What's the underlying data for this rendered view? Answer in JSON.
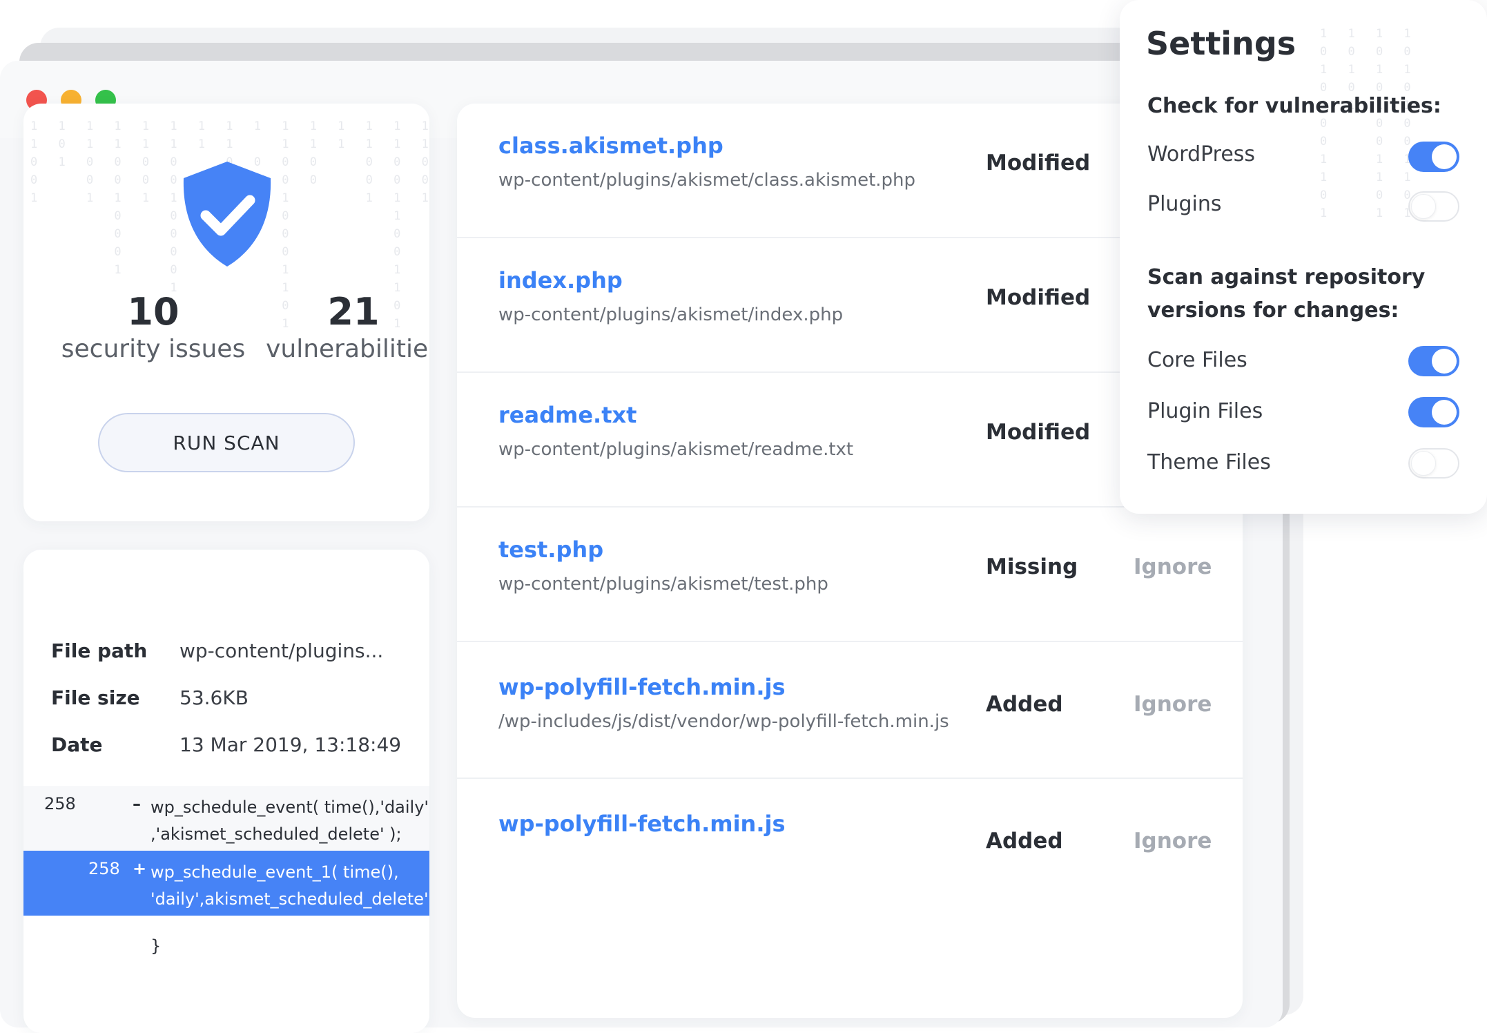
{
  "summary": {
    "security_issues_count": "10",
    "security_issues_label": "security issues",
    "vulnerabilities_count": "21",
    "vulnerabilities_label": "vulnerabilities",
    "run_scan_label": "RUN SCAN"
  },
  "details": {
    "file_path_label": "File path",
    "file_path_value": "wp-content/plugins...",
    "file_size_label": "File size",
    "file_size_value": "53.6KB",
    "date_label": "Date",
    "date_value": "13 Mar 2019, 13:18:49",
    "diff": {
      "removed_line_number": "258",
      "removed_sign": "–",
      "removed_code_1": "wp_schedule_event( time(),'daily'",
      "removed_code_2": ",'akismet_scheduled_delete' );",
      "added_line_number": "258",
      "added_sign": "+",
      "added_code_1": "wp_schedule_event_1( time(),",
      "added_code_2": "'daily',akismet_scheduled_delete' );",
      "closing": "}"
    }
  },
  "files": [
    {
      "name": "class.akismet.php",
      "path": "wp-content/plugins/akismet/class.akismet.php",
      "status": "Modified",
      "action": ""
    },
    {
      "name": "index.php",
      "path": "wp-content/plugins/akismet/index.php",
      "status": "Modified",
      "action": ""
    },
    {
      "name": "readme.txt",
      "path": "wp-content/plugins/akismet/readme.txt",
      "status": "Modified",
      "action": ""
    },
    {
      "name": "test.php",
      "path": "wp-content/plugins/akismet/test.php",
      "status": "Missing",
      "action": "Ignore"
    },
    {
      "name": "wp-polyfill-fetch.min.js",
      "path": "/wp-includes/js/dist/vendor/wp-polyfill-fetch.min.js",
      "status": "Added",
      "action": "Ignore"
    },
    {
      "name": "wp-polyfill-fetch.min.js",
      "path": "",
      "status": "Added",
      "action": "Ignore"
    }
  ],
  "settings": {
    "title": "Settings",
    "section1_heading": "Check for vulnerabilities:",
    "wordpress_label": "WordPress",
    "wordpress_on": true,
    "plugins_label": "Plugins",
    "plugins_on": false,
    "section2_heading_line1": "Scan against repository",
    "section2_heading_line2": "versions for changes:",
    "core_files_label": "Core Files",
    "core_files_on": true,
    "plugin_files_label": "Plugin Files",
    "plugin_files_on": true,
    "theme_files_label": "Theme Files",
    "theme_files_on": false
  },
  "colors": {
    "accent": "#4683f6",
    "link": "#3b82f6",
    "traffic_red": "#f2544e",
    "traffic_yellow": "#f7b131",
    "traffic_green": "#34c14a"
  }
}
